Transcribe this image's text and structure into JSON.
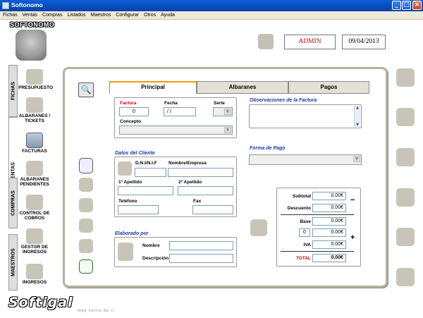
{
  "window": {
    "title": "Softonomo",
    "min": "_",
    "max": "□",
    "close": "×"
  },
  "menu": [
    "Fichas",
    "Ventas",
    "Compras",
    "Listados",
    "Maestros",
    "Configurar",
    "Otros",
    "Ayuda"
  ],
  "logo": {
    "text": "SOFTONOMO"
  },
  "header": {
    "user": "ADMIN",
    "date": "09/04/2013"
  },
  "left_tabs": [
    "FICHAS",
    "VENTAS",
    "COMPRAS",
    "MAESTROS"
  ],
  "left_buttons": [
    {
      "label": "PRESUPUESTO"
    },
    {
      "label": "ALBARANES / TICKETS"
    },
    {
      "label": "FACTURAS"
    },
    {
      "label": "ALBARANES PENDIENTES"
    },
    {
      "label": "CONTROL DE COBROS"
    },
    {
      "label": "GESTOR DE INGRESOS"
    },
    {
      "label": "INGRESOS"
    }
  ],
  "tabs": [
    "Principal",
    "Albaranes",
    "Pagos"
  ],
  "factura": {
    "factura_label": "Factura",
    "factura_value": "0",
    "fecha_label": "Fecha",
    "fecha_value": "/ /",
    "serie_label": "Serie",
    "concepto_label": "Concepto"
  },
  "observaciones": {
    "title": "Observaciones de la Factura"
  },
  "cliente": {
    "title": "Datos del Cliente",
    "dni_label": "D.N.I/N.I.F",
    "nombre_label": "Nombre/Empresa",
    "apellido1_label": "1º Apellido",
    "apellido2_label": "2º Apellido",
    "telefono_label": "Teléfono",
    "fax_label": "Fax"
  },
  "forma_pago": {
    "title": "Forma de Pago"
  },
  "elaborado": {
    "title": "Elaborado por",
    "nombre_label": "Nombre",
    "descripcion_label": "Descripción"
  },
  "totales": {
    "subtotal_label": "Subtotal",
    "subtotal": "0.00€",
    "descuento_label": "Descuento",
    "descuento": "0.00€",
    "base_label": "Base",
    "base": "0.00€",
    "pct_value": "0",
    "pct_amount": "0.00€",
    "iva_label": "IVA",
    "iva": "0.00€",
    "total_label": "TOTAL",
    "total": "0.00€",
    "minus": "−",
    "plus": "+"
  },
  "footer": {
    "brand": "Softigal",
    "tagline": "más cerca de ti"
  }
}
